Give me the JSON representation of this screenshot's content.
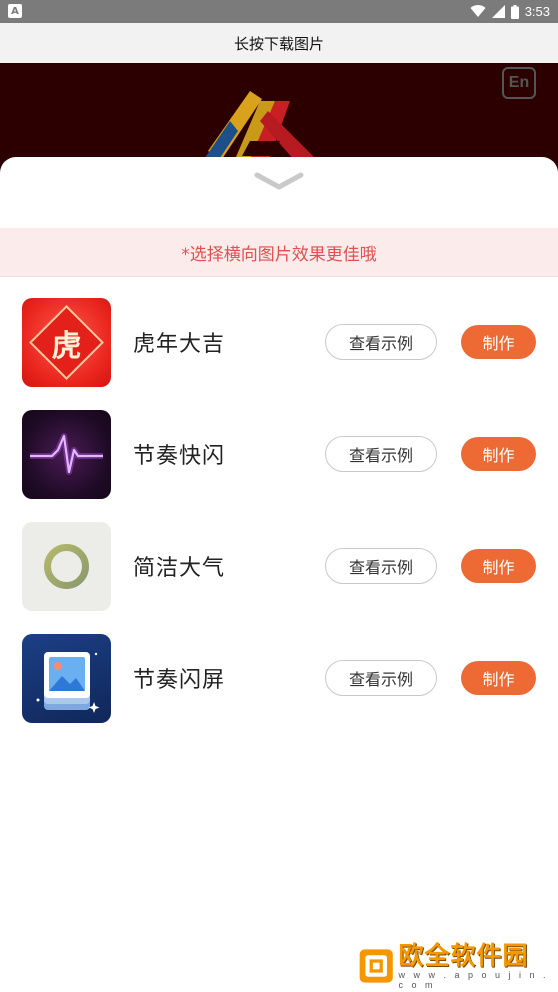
{
  "status_bar": {
    "left_badge": "A",
    "time": "3:53",
    "icons": [
      "wifi-icon",
      "signal-icon",
      "battery-icon"
    ]
  },
  "title_bar": {
    "title": "长按下载图片"
  },
  "banner": {
    "lang_button": "En"
  },
  "sheet": {
    "tip": "*选择横向图片效果更佳哦",
    "items": [
      {
        "title": "虎年大吉",
        "thumb_char": "虎",
        "example_label": "查看示例",
        "make_label": "制作"
      },
      {
        "title": "节奏快闪",
        "example_label": "查看示例",
        "make_label": "制作"
      },
      {
        "title": "简洁大气",
        "example_label": "查看示例",
        "make_label": "制作"
      },
      {
        "title": "节奏闪屏",
        "example_label": "查看示例",
        "make_label": "制作"
      }
    ]
  },
  "watermark": {
    "name": "欧全软件园",
    "url": "w w w . a p o u j i n . c o m"
  },
  "colors": {
    "accent": "#ee6a35",
    "tip_text": "#e0504f",
    "tip_bg": "#fbebeb",
    "banner": "#2d0000"
  }
}
